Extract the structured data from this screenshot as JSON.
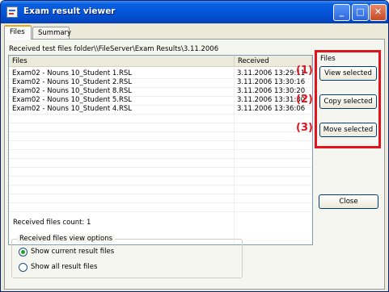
{
  "window": {
    "title": "Exam result viewer",
    "minimize_glyph": "_",
    "maximize_glyph": "□",
    "close_glyph": "✕"
  },
  "tabs": [
    {
      "label": "Files",
      "active": true
    },
    {
      "label": "Summary",
      "active": false
    }
  ],
  "folder": {
    "label": "Received test files folder",
    "path": "\\\\FileServer\\Exam Results\\3.11.2006"
  },
  "file_list": {
    "columns": [
      "Files",
      "Received"
    ],
    "rows": [
      {
        "file": "Exam02 - Nouns 10_Student 1.RSL",
        "received": "3.11.2006 13:29:11"
      },
      {
        "file": "Exam02 - Nouns 10_Student 2.RSL",
        "received": "3.11.2006 13:30:16"
      },
      {
        "file": "Exam02 - Nouns 10_Student 8.RSL",
        "received": "3.11.2006 13:30:20"
      },
      {
        "file": "Exam02 - Nouns 10_Student 5.RSL",
        "received": "3.11.2006 13:31:30"
      },
      {
        "file": "Exam02 - Nouns 10_Student 4.RSL",
        "received": "3.11.2006 13:36:06"
      }
    ]
  },
  "files_actions": {
    "group_label": "Files",
    "view_label": "View selected",
    "copy_label": "Copy selected",
    "move_label": "Move selected",
    "markers": [
      "(1)",
      "(2)",
      "(3)"
    ],
    "highlight_color": "#e0141e"
  },
  "close_label": "Close",
  "received_count": {
    "label": "Received files count:",
    "value": "1"
  },
  "view_options": {
    "title": "Received files view options",
    "options": [
      {
        "label": "Show current result files",
        "selected": true
      },
      {
        "label": "Show all result files",
        "selected": false
      }
    ]
  }
}
